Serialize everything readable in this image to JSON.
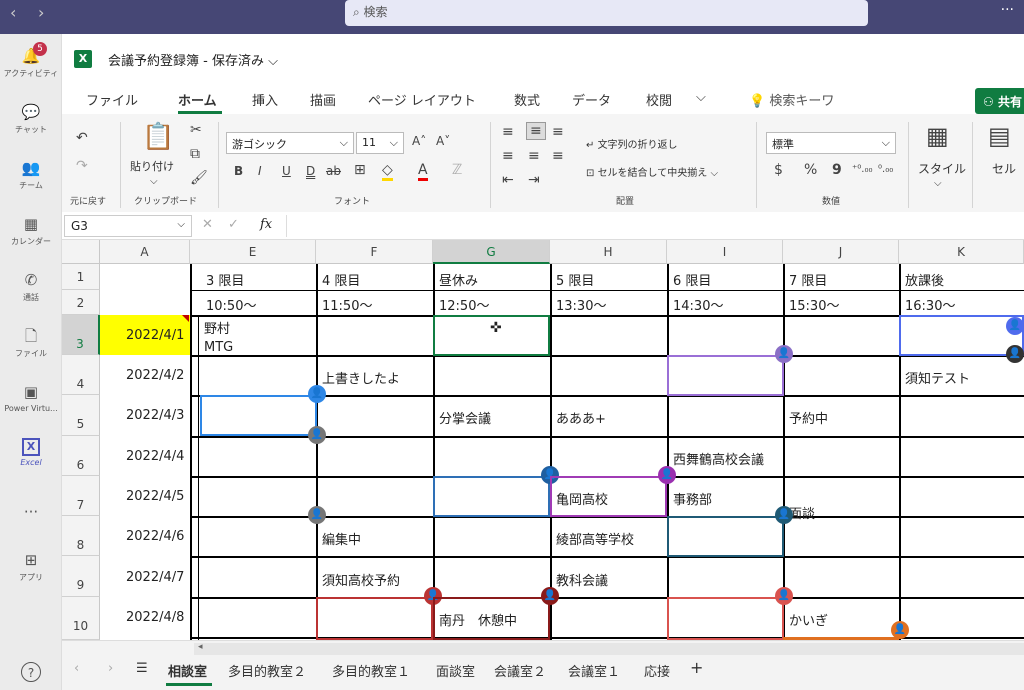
{
  "topbar": {
    "search_placeholder": "検索",
    "back": "‹",
    "forward": "›",
    "more": "···"
  },
  "rail": {
    "activity_badge": "5",
    "items": [
      {
        "label": "アクティビティ",
        "icon": "bell-icon",
        "glyph": "🔔"
      },
      {
        "label": "チャット",
        "icon": "chat-icon",
        "glyph": "💬"
      },
      {
        "label": "チーム",
        "icon": "teams-icon",
        "glyph": "👥"
      },
      {
        "label": "カレンダー",
        "icon": "calendar-icon",
        "glyph": "▦"
      },
      {
        "label": "通話",
        "icon": "phone-icon",
        "glyph": "✆"
      },
      {
        "label": "ファイル",
        "icon": "file-icon",
        "glyph": "🗋"
      },
      {
        "label": "Power Virtu...",
        "icon": "power-virtual-agents-icon",
        "glyph": "▣"
      },
      {
        "label": "Excel",
        "icon": "excel-icon",
        "glyph": "X"
      },
      {
        "label": "",
        "icon": "more-apps-icon",
        "glyph": "···"
      },
      {
        "label": "アプリ",
        "icon": "apps-icon",
        "glyph": "⊞"
      },
      {
        "label": "",
        "icon": "help-icon",
        "glyph": "?"
      }
    ]
  },
  "doc": {
    "title": "会議予約登録簿 - 保存済み",
    "caret": "⌵"
  },
  "ribbon_tabs": [
    "ファイル",
    "ホーム",
    "挿入",
    "描画",
    "ページ レイアウト",
    "数式",
    "データ",
    "校閲"
  ],
  "ribbon_more": "⌵",
  "tell_me": "検索キーワ",
  "share_label": "共有",
  "ribbon": {
    "undo_label": "元に戻す",
    "paste_label": "貼り付け",
    "clipboard_label": "クリップボード",
    "font_name": "游ゴシック",
    "font_size": "11",
    "font_label": "フォント",
    "wrap_text": "文字列の折り返し",
    "merge_center": "セルを結合して中央揃え",
    "align_label": "配置",
    "number_format": "標準",
    "number_label": "数値",
    "styles_label": "スタイル",
    "cells_label": "セル",
    "bold": "B",
    "italic": "I",
    "underline": "U",
    "dunder": "D",
    "strike": "ab",
    "grow": "A˄",
    "shrink": "A˅",
    "currency": "$",
    "percent": "%",
    "comma": "9",
    "inc_dec": "⁺⁰.₀₀",
    "dec_dec": "⁰.₀₀"
  },
  "formula_bar": {
    "name_box": "G3",
    "fx": "fx",
    "cancel": "✕",
    "enter": "✓",
    "value": ""
  },
  "grid": {
    "columns": [
      "A",
      "E",
      "F",
      "G",
      "H",
      "I",
      "J",
      "K"
    ],
    "rows": [
      "1",
      "2",
      "3",
      "4",
      "5",
      "6",
      "7",
      "8",
      "9",
      "10"
    ],
    "periods": [
      "3 限目",
      "4 限目",
      "昼休み",
      "5 限目",
      "6 限目",
      "7 限目",
      "放課後"
    ],
    "times": [
      "10:50～",
      "11:50～",
      "12:50～",
      "13:30～",
      "14:30～",
      "15:30～",
      "16:30～"
    ],
    "dates": [
      "2022/4/1",
      "2022/4/2",
      "2022/4/3",
      "2022/4/4",
      "2022/4/5",
      "2022/4/6",
      "2022/4/7",
      "2022/4/8"
    ],
    "entries": {
      "e3a": "野村",
      "e3b": "MTG",
      "f4": "上書きしたよ",
      "k4": "須知テスト",
      "g5": "分掌会議",
      "h5": "あああ+",
      "j5": "予約中",
      "i6": "西舞鶴高校会議",
      "h7": "亀岡高校",
      "i7": "事務部",
      "j7": "面談",
      "f8": "編集中",
      "h8": "綾部高等学校",
      "f9": "須知高校予約",
      "h9": "教科会議",
      "g10": "南丹　休憩中",
      "j10": "かいぎ"
    }
  },
  "sheets": {
    "tabs": [
      "相談室",
      "多目的教室２",
      "多目的教室１",
      "面談室",
      "会議室２",
      "会議室１",
      "応接"
    ],
    "add": "+",
    "menu": "☰"
  },
  "colors": {
    "teams_purple": "#464775",
    "excel_green": "#107c41",
    "date_highlight": "#ffff00"
  }
}
